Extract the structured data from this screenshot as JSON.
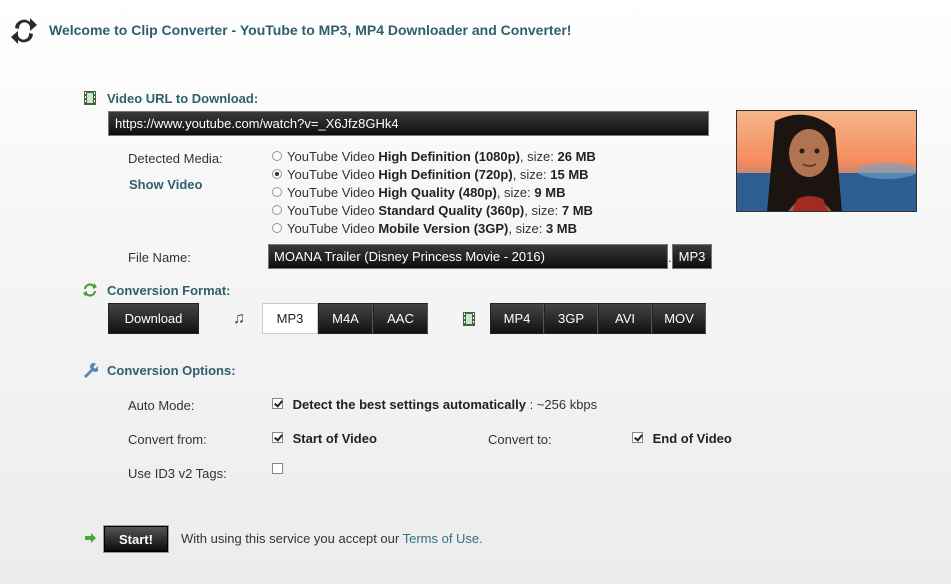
{
  "header": {
    "welcome": "Welcome to Clip Converter - YouTube to MP3, MP4 Downloader and Converter!"
  },
  "url_section": {
    "title": "Video URL to Download:",
    "url_value": "https://www.youtube.com/watch?v=_X6Jfz8GHk4"
  },
  "media": {
    "detected_label": "Detected Media:",
    "show_video": "Show Video",
    "selected_index": 1,
    "options": [
      {
        "prefix": "YouTube Video",
        "quality": "High Definition (1080p)",
        "size_label": ", size:",
        "size": "26 MB"
      },
      {
        "prefix": "YouTube Video",
        "quality": "High Definition (720p)",
        "size_label": ", size:",
        "size": "15 MB"
      },
      {
        "prefix": "YouTube Video",
        "quality": "High Quality (480p)",
        "size_label": ", size:",
        "size": "9 MB"
      },
      {
        "prefix": "YouTube Video",
        "quality": "Standard Quality (360p)",
        "size_label": ", size:",
        "size": "7 MB"
      },
      {
        "prefix": "YouTube Video",
        "quality": "Mobile Version (3GP)",
        "size_label": ", size:",
        "size": "3 MB"
      }
    ]
  },
  "file": {
    "label": "File Name:",
    "name": "MOANA Trailer (Disney Princess Movie - 2016)",
    "ext_sep": ".",
    "ext": "MP3"
  },
  "format": {
    "title": "Conversion Format:",
    "download_label": "Download",
    "audio": [
      "MP3",
      "M4A",
      "AAC"
    ],
    "audio_selected": "MP3",
    "video": [
      "MP4",
      "3GP",
      "AVI",
      "MOV"
    ]
  },
  "options": {
    "title": "Conversion Options:",
    "auto_mode_label": "Auto Mode:",
    "auto_mode_text": "Detect the best settings automatically",
    "auto_mode_extra": " : ~256 kbps",
    "auto_mode_checked": true,
    "convert_from_label": "Convert from:",
    "convert_from_value": "Start of Video",
    "convert_from_checked": true,
    "convert_to_label": "Convert to:",
    "convert_to_value": "End of Video",
    "convert_to_checked": true,
    "id3_label": "Use ID3 v2 Tags:",
    "id3_checked": false
  },
  "footer": {
    "start_label": "Start!",
    "terms_prefix": "With using this service you accept our ",
    "terms_link": "Terms of Use",
    "terms_suffix": "."
  },
  "colors": {
    "heading": "#2f5f6e",
    "link": "#2f6f86"
  },
  "icons": [
    "refresh-arrows-icon",
    "film-strip-icon",
    "convert-arrows-icon",
    "wrench-icon",
    "music-note-icon",
    "start-arrow-icon"
  ]
}
